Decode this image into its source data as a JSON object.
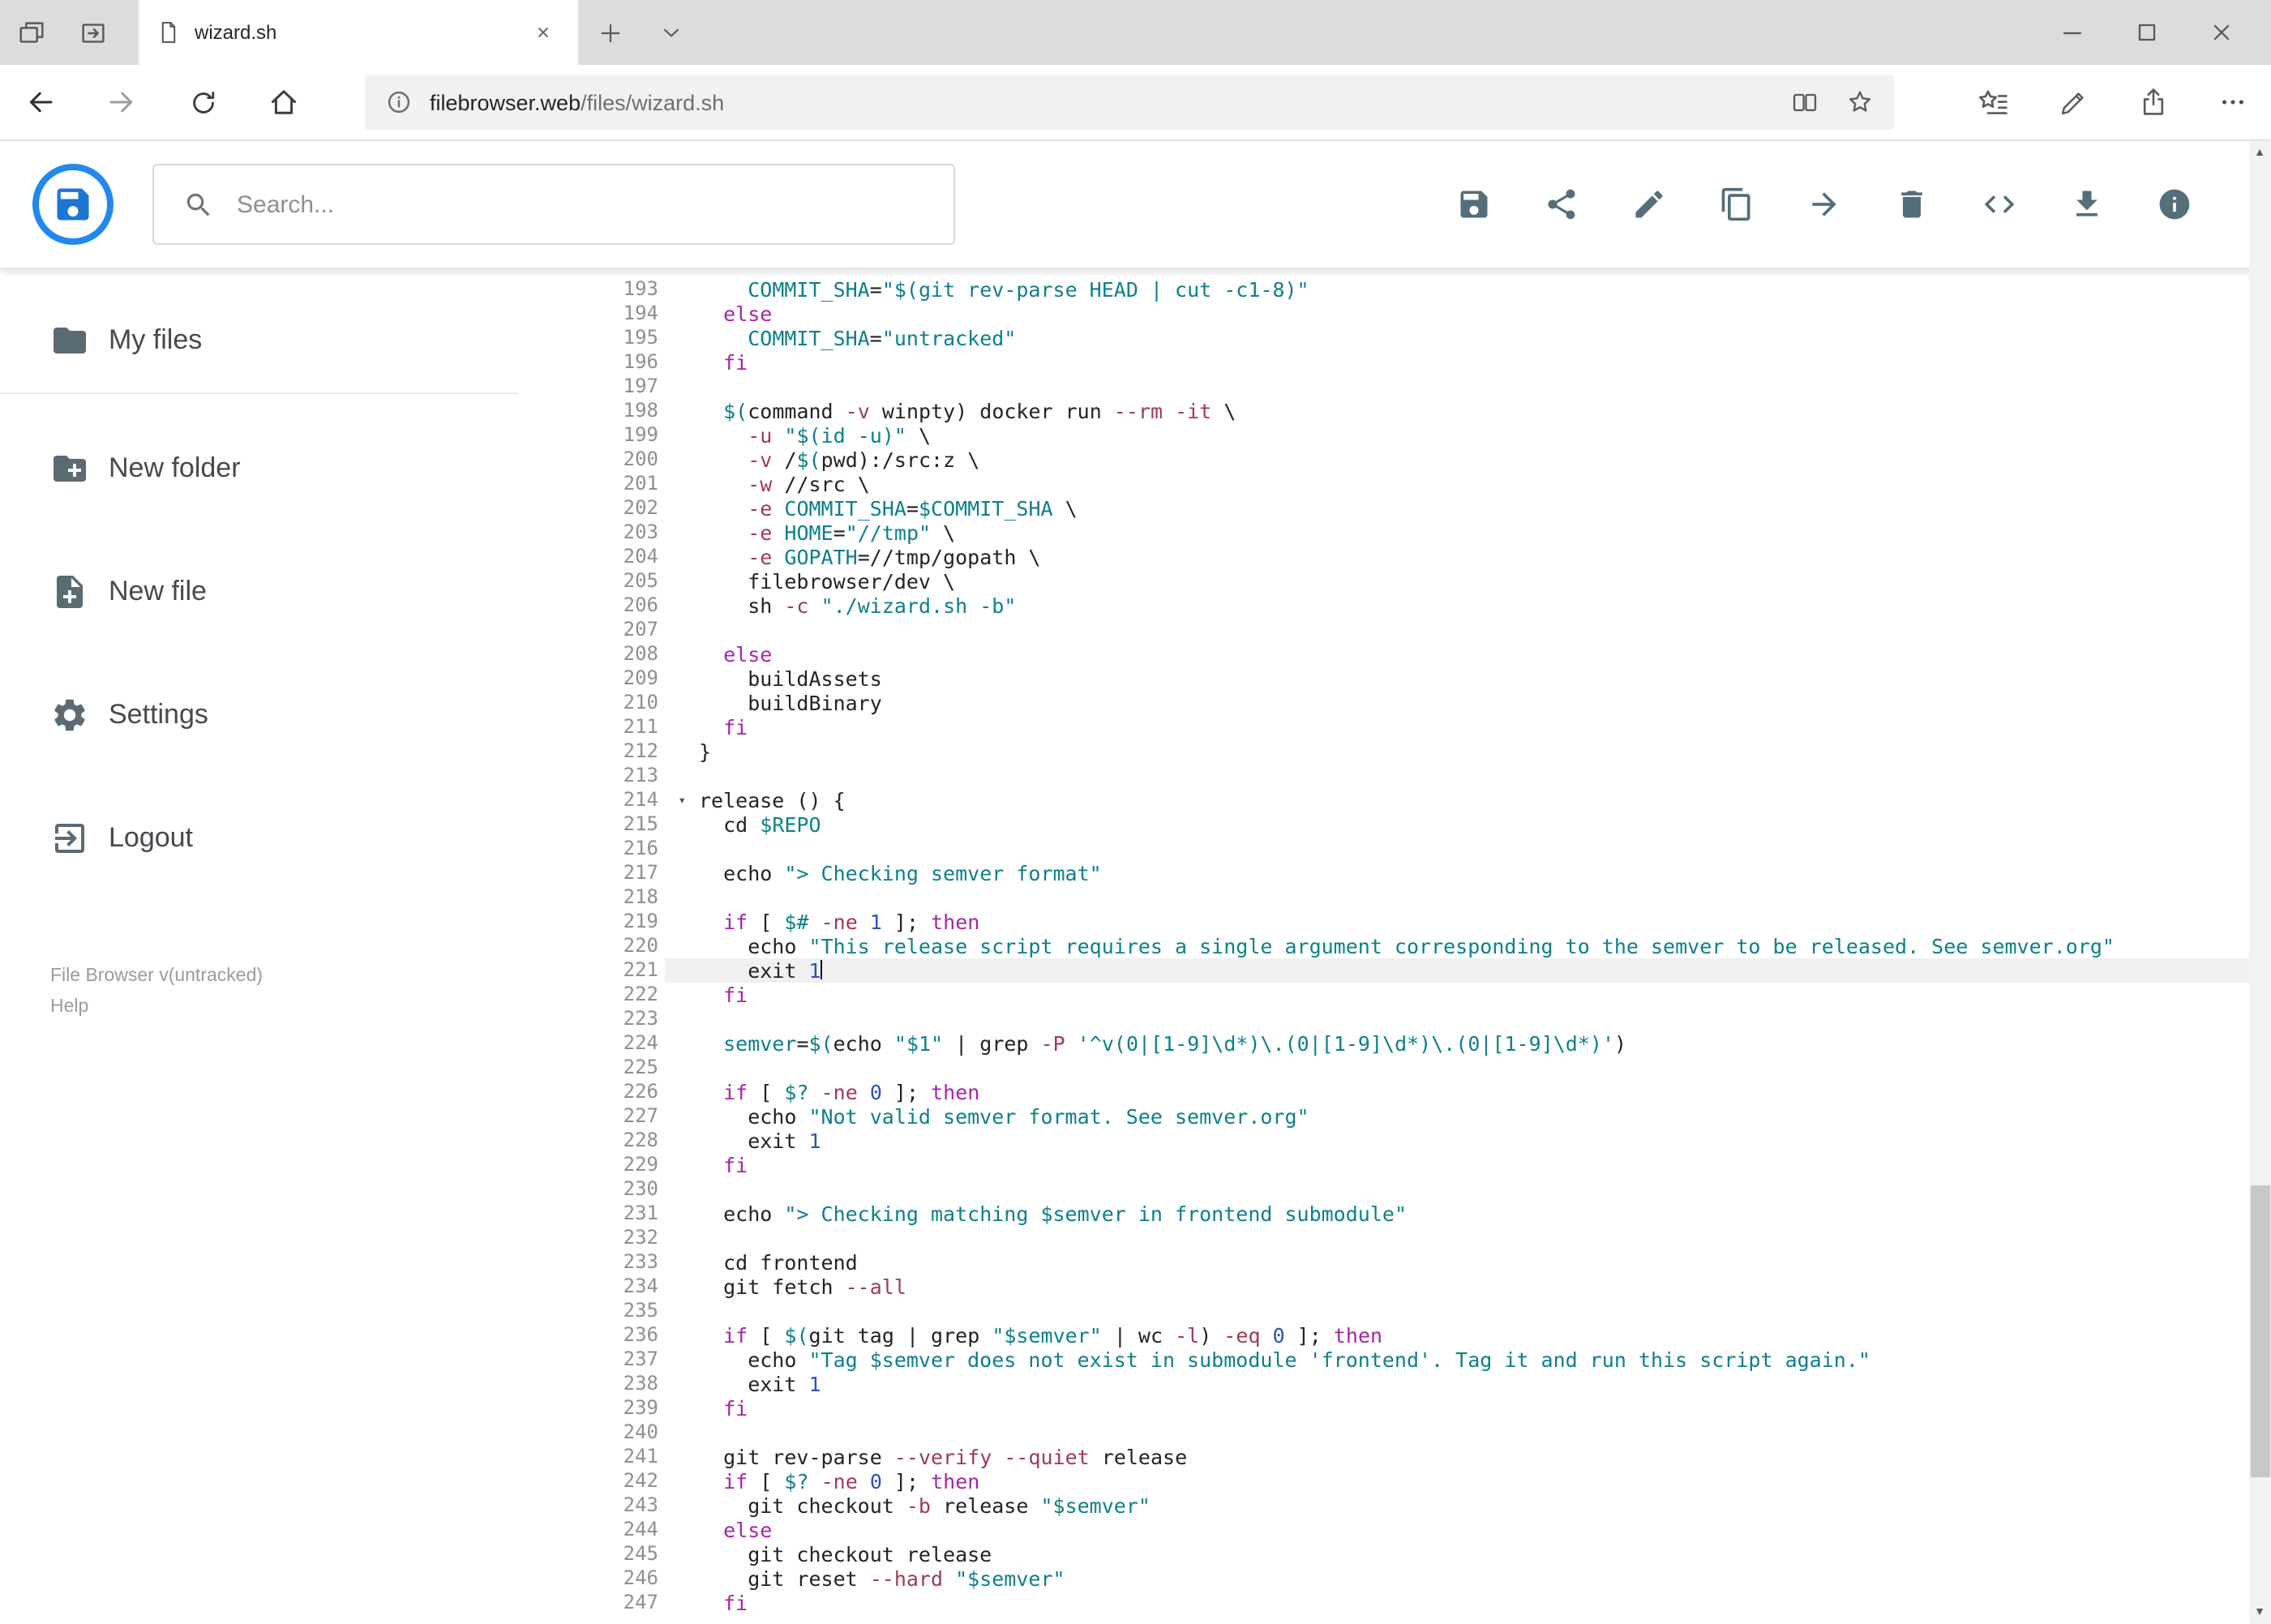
{
  "browser": {
    "tab_title": "wizard.sh",
    "url": {
      "host": "filebrowser.web",
      "path": "/files/wizard.sh"
    }
  },
  "app": {
    "search_placeholder": "Search...",
    "sidebar": {
      "items": [
        {
          "id": "my-files",
          "icon": "folder",
          "label": "My files"
        },
        {
          "id": "new-folder",
          "icon": "folder-plus",
          "label": "New folder"
        },
        {
          "id": "new-file",
          "icon": "file-plus",
          "label": "New file"
        },
        {
          "id": "settings",
          "icon": "gear",
          "label": "Settings"
        },
        {
          "id": "logout",
          "icon": "logout",
          "label": "Logout"
        }
      ],
      "footer_version": "File Browser v(untracked)",
      "footer_help": "Help"
    },
    "toolbar": [
      {
        "id": "save",
        "icon": "save"
      },
      {
        "id": "share",
        "icon": "share"
      },
      {
        "id": "edit",
        "icon": "pencil"
      },
      {
        "id": "copy",
        "icon": "copy"
      },
      {
        "id": "move",
        "icon": "arrow-right"
      },
      {
        "id": "delete",
        "icon": "trash"
      },
      {
        "id": "raw-code",
        "icon": "code"
      },
      {
        "id": "download",
        "icon": "download"
      },
      {
        "id": "info",
        "icon": "info"
      }
    ]
  },
  "editor": {
    "first_line": 193,
    "active_line": 221,
    "folded_marker_line": 214,
    "colors": {
      "keyword": "#a626a4",
      "string": "#0d808a",
      "variable": "#0d808a",
      "flag": "#a03a52",
      "number": "#2a52bd",
      "text": "#232323",
      "line_number": "#8f8f8f",
      "active_line_bg": "#f0f0f0"
    },
    "lines": [
      "    COMMIT_SHA=\"$(git rev-parse HEAD | cut -c1-8)\"",
      "  else",
      "    COMMIT_SHA=\"untracked\"",
      "  fi",
      "",
      "  $(command -v winpty) docker run --rm -it \\",
      "    -u \"$(id -u)\" \\",
      "    -v /$(pwd):/src:z \\",
      "    -w //src \\",
      "    -e COMMIT_SHA=$COMMIT_SHA \\",
      "    -e HOME=\"//tmp\" \\",
      "    -e GOPATH=//tmp/gopath \\",
      "    filebrowser/dev \\",
      "    sh -c \"./wizard.sh -b\"",
      "",
      "  else",
      "    buildAssets",
      "    buildBinary",
      "  fi",
      "}",
      "",
      "release () {",
      "  cd $REPO",
      "",
      "  echo \"> Checking semver format\"",
      "",
      "  if [ $# -ne 1 ]; then",
      "    echo \"This release script requires a single argument corresponding to the semver to be released. See semver.org\"",
      "    exit 1",
      "  fi",
      "",
      "  semver=$(echo \"$1\" | grep -P '^v(0|[1-9]\\d*)\\.(0|[1-9]\\d*)\\.(0|[1-9]\\d*)')",
      "",
      "  if [ $? -ne 0 ]; then",
      "    echo \"Not valid semver format. See semver.org\"",
      "    exit 1",
      "  fi",
      "",
      "  echo \"> Checking matching $semver in frontend submodule\"",
      "",
      "  cd frontend",
      "  git fetch --all",
      "",
      "  if [ $(git tag | grep \"$semver\" | wc -l) -eq 0 ]; then",
      "    echo \"Tag $semver does not exist in submodule 'frontend'. Tag it and run this script again.\"",
      "    exit 1",
      "  fi",
      "",
      "  git rev-parse --verify --quiet release",
      "  if [ $? -ne 0 ]; then",
      "    git checkout -b release \"$semver\"",
      "  else",
      "    git checkout release",
      "    git reset --hard \"$semver\"",
      "  fi"
    ]
  }
}
